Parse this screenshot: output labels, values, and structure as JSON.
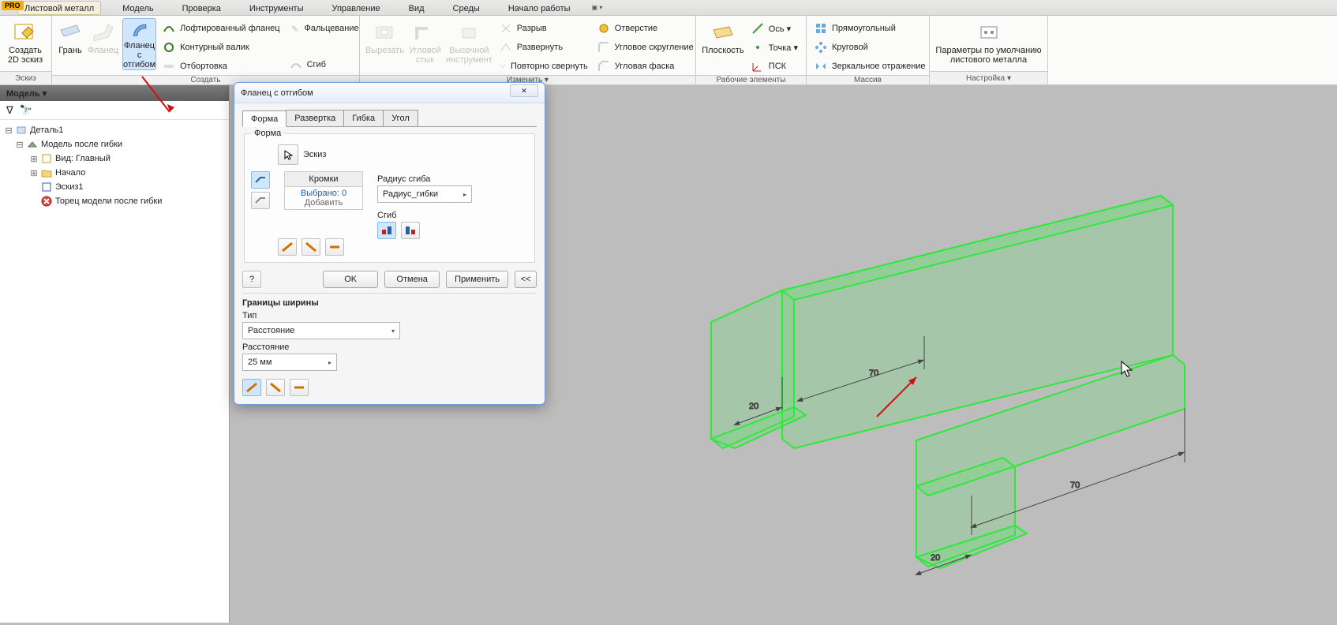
{
  "app_badge": "PRO",
  "menubar": {
    "items": [
      "Листовой металл",
      "Модель",
      "Проверка",
      "Инструменты",
      "Управление",
      "Вид",
      "Среды",
      "Начало работы"
    ]
  },
  "ribbon": {
    "groups": {
      "sketch": {
        "footer": "Эскиз",
        "btn": "Создать\n2D эскиз"
      },
      "create": {
        "footer": "Создать",
        "face": "Грань",
        "flange": "Фланец",
        "flange_bend": "Фланец с\nотгибом",
        "loft_flange": "Лофтированный фланец",
        "fold": "Фальцевание",
        "contour_roll": "Контурный валик",
        "trim": "Отбортовка",
        "bend_small": "Сгиб"
      },
      "edit": {
        "footer": "Изменить ▾",
        "cut": "Вырезать",
        "corner": "Угловой\nстык",
        "punch": "Высечной\nинструмент",
        "split": "Разрыв",
        "unfold": "Развернуть",
        "refold": "Повторно свернуть",
        "hole": "Отверстие",
        "round": "Угловое скругление",
        "chamfer": "Угловая фаска"
      },
      "work": {
        "footer": "Рабочие элементы",
        "plane": "Плоскость",
        "axis": "Ось ▾",
        "point": "Точка ▾",
        "ucs": "ПСК"
      },
      "array": {
        "footer": "Массив",
        "rect": "Прямоугольный",
        "circ": "Круговой",
        "mirror": "Зеркальное отражение"
      },
      "setup": {
        "footer": "Настройка ▾",
        "defaults": "Параметры по умолчанию\nлистового металла"
      }
    }
  },
  "panel": {
    "header": "Модель ▾",
    "part": "Деталь1",
    "nodes": {
      "folded": "Модель после гибки",
      "view": "Вид: Главный",
      "origin": "Начало",
      "sketch": "Эскиз1",
      "end": "Торец модели после гибки"
    }
  },
  "panel_close": "×",
  "dialog": {
    "title": "Фланец с отгибом",
    "tabs": [
      "Форма",
      "Развертка",
      "Гибка",
      "Угол"
    ],
    "form_group": "Форма",
    "sketch_btn": "Эскиз",
    "edges_hdr": "Кромки",
    "edges_sel": "Выбрано: 0",
    "edges_add": "Добавить",
    "bend_radius_lbl": "Радиус сгиба",
    "bend_radius_val": "Радиус_гибки",
    "fold_lbl": "Сгиб",
    "ok": "OK",
    "cancel": "Отмена",
    "apply": "Применить",
    "more": "<<",
    "width_group": "Границы ширины",
    "type_lbl": "Тип",
    "type_val": "Расстояние",
    "distance_lbl": "Расстояние",
    "distance_val": "25 мм"
  },
  "dims": {
    "d1": "20",
    "d2": "70",
    "d3": "70",
    "d4": "20"
  }
}
